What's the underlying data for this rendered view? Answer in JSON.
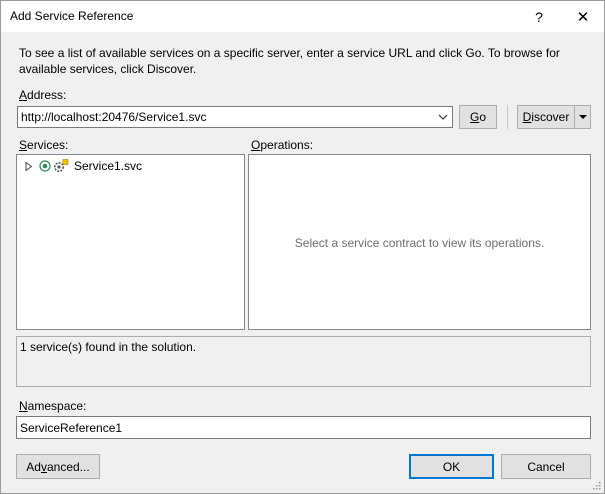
{
  "window": {
    "title": "Add Service Reference",
    "help_label": "?",
    "close_label": "✕"
  },
  "description": "To see a list of available services on a specific server, enter a service URL and click Go. To browse for available services, click Discover.",
  "address": {
    "label_accel": "A",
    "label_rest": "ddress:",
    "value": "http://localhost:20476/Service1.svc"
  },
  "buttons": {
    "go_accel": "G",
    "go_rest": "o",
    "discover_accel": "D",
    "discover_rest": "iscover",
    "advanced_pre": "Ad",
    "advanced_accel": "v",
    "advanced_post": "anced...",
    "ok": "OK",
    "cancel": "Cancel"
  },
  "services": {
    "label_accel": "S",
    "label_rest": "ervices:",
    "items": [
      {
        "label": "Service1.svc"
      }
    ]
  },
  "operations": {
    "label_accel": "O",
    "label_rest": "perations:",
    "empty_message": "Select a service contract to view its operations."
  },
  "status": "1 service(s) found in the solution.",
  "namespace": {
    "label_accel": "N",
    "label_rest": "amespace:",
    "value": "ServiceReference1"
  },
  "icons": {
    "expand": "chevron-right-icon",
    "service": "service-icon",
    "dropdown": "chevron-down-icon",
    "grip": "resize-grip-icon"
  }
}
